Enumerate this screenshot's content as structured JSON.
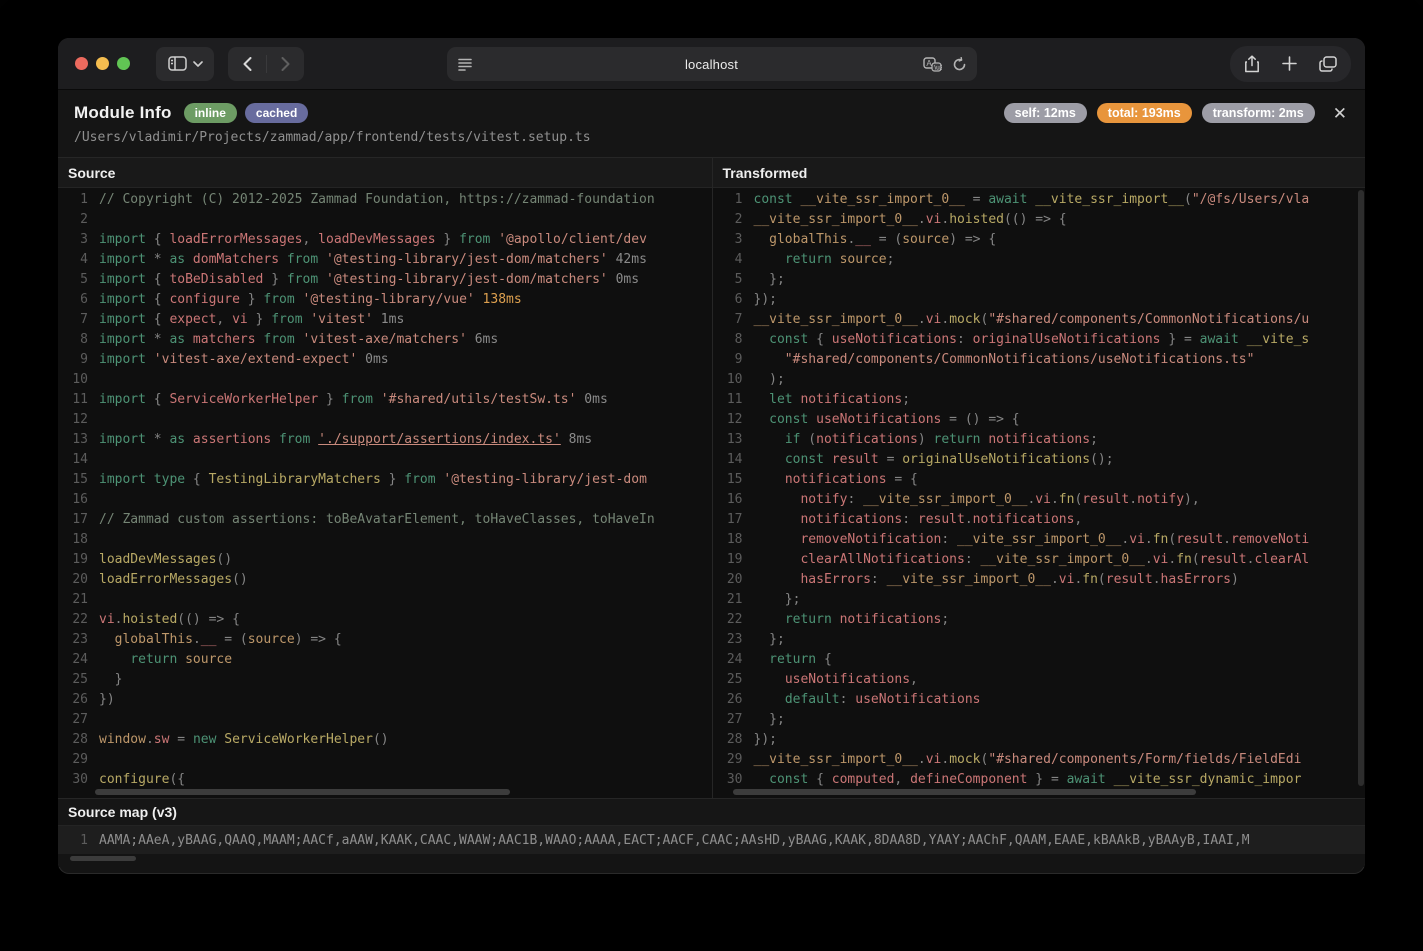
{
  "browser": {
    "url": "localhost",
    "icons": {
      "sidebar": "sidebar-toggle",
      "chevron_down": "chevron-down",
      "back": "chevron-left",
      "forward": "chevron-right",
      "reader": "reader-lines",
      "translate": "translate-badge",
      "reload": "reload-arrow",
      "share": "share-arrow-up",
      "new_tab": "+",
      "tabs": "tab-overview",
      "close": "✕"
    }
  },
  "colors": {
    "badge_inline": "#6d9c64",
    "badge_cached": "#686c9e",
    "pill_gray": "#9d9da6",
    "pill_orange": "#e8953c",
    "syntax": {
      "k": "#4d9375",
      "v": "#bd976a",
      "f": "#b8a965",
      "p": "#cb7676",
      "s": "#c98a7d",
      "c": "#758575",
      "o": "#858585",
      "t": "#8a8a8a",
      "h": "#dda04f",
      "ln": "#5c5c5c"
    }
  },
  "header": {
    "title": "Module Info",
    "badges": [
      {
        "label": "inline",
        "color": "#6d9c64"
      },
      {
        "label": "cached",
        "color": "#686c9e"
      }
    ],
    "timings": [
      {
        "label": "self: 12ms",
        "style": "gray"
      },
      {
        "label": "total: 193ms",
        "style": "orange"
      },
      {
        "label": "transform: 2ms",
        "style": "gray"
      }
    ],
    "file_path": "/Users/vladimir/Projects/zammad/app/frontend/tests/vitest.setup.ts",
    "close_glyph": "✕"
  },
  "panels": {
    "source": {
      "title": "Source",
      "lines": [
        [
          [
            "c",
            "// Copyright (C) 2012-2025 Zammad Foundation, https://zammad-foundation"
          ]
        ],
        [],
        [
          [
            "k",
            "import"
          ],
          [
            "o",
            " { "
          ],
          [
            "p",
            "loadErrorMessages"
          ],
          [
            "o",
            ", "
          ],
          [
            "p",
            "loadDevMessages"
          ],
          [
            "o",
            " } "
          ],
          [
            "k",
            "from"
          ],
          [
            "s",
            " '@apollo/client/dev"
          ]
        ],
        [
          [
            "k",
            "import"
          ],
          [
            "o",
            " * "
          ],
          [
            "k",
            "as"
          ],
          [
            "p",
            " domMatchers "
          ],
          [
            "k",
            "from"
          ],
          [
            "s",
            " '@testing-library/jest-dom/matchers'"
          ],
          [
            "t",
            " 42ms"
          ]
        ],
        [
          [
            "k",
            "import"
          ],
          [
            "o",
            " { "
          ],
          [
            "p",
            "toBeDisabled"
          ],
          [
            "o",
            " } "
          ],
          [
            "k",
            "from"
          ],
          [
            "s",
            " '@testing-library/jest-dom/matchers'"
          ],
          [
            "t",
            " 0ms"
          ]
        ],
        [
          [
            "k",
            "import"
          ],
          [
            "o",
            " { "
          ],
          [
            "p",
            "configure"
          ],
          [
            "o",
            " } "
          ],
          [
            "k",
            "from"
          ],
          [
            "s",
            " '@testing-library/vue'"
          ],
          [
            "h",
            " 138ms"
          ]
        ],
        [
          [
            "k",
            "import"
          ],
          [
            "o",
            " { "
          ],
          [
            "p",
            "expect"
          ],
          [
            "o",
            ", "
          ],
          [
            "p",
            "vi"
          ],
          [
            "o",
            " } "
          ],
          [
            "k",
            "from"
          ],
          [
            "s",
            " 'vitest'"
          ],
          [
            "t",
            " 1ms"
          ]
        ],
        [
          [
            "k",
            "import"
          ],
          [
            "o",
            " * "
          ],
          [
            "k",
            "as"
          ],
          [
            "p",
            " matchers "
          ],
          [
            "k",
            "from"
          ],
          [
            "s",
            " 'vitest-axe/matchers'"
          ],
          [
            "t",
            " 6ms"
          ]
        ],
        [
          [
            "k",
            "import"
          ],
          [
            "s",
            " 'vitest-axe/extend-expect'"
          ],
          [
            "t",
            " 0ms"
          ]
        ],
        [],
        [
          [
            "k",
            "import"
          ],
          [
            "o",
            " { "
          ],
          [
            "p",
            "ServiceWorkerHelper"
          ],
          [
            "o",
            " } "
          ],
          [
            "k",
            "from"
          ],
          [
            "s",
            " '#shared/utils/testSw.ts'"
          ],
          [
            "t",
            " 0ms"
          ]
        ],
        [],
        [
          [
            "k",
            "import"
          ],
          [
            "o",
            " * "
          ],
          [
            "k",
            "as"
          ],
          [
            "p",
            " assertions "
          ],
          [
            "k",
            "from"
          ],
          [
            "o",
            " "
          ],
          [
            "su",
            "'./support/assertions/index.ts'"
          ],
          [
            "t",
            " 8ms"
          ]
        ],
        [],
        [
          [
            "k",
            "import"
          ],
          [
            "o",
            " "
          ],
          [
            "k",
            "type"
          ],
          [
            "o",
            " { "
          ],
          [
            "f",
            "TestingLibraryMatchers"
          ],
          [
            "o",
            " } "
          ],
          [
            "k",
            "from"
          ],
          [
            "s",
            " '@testing-library/jest-dom"
          ]
        ],
        [],
        [
          [
            "c",
            "// Zammad custom assertions: toBeAvatarElement, toHaveClasses, toHaveIn"
          ]
        ],
        [],
        [
          [
            "f",
            "loadDevMessages"
          ],
          [
            "o",
            "()"
          ]
        ],
        [
          [
            "f",
            "loadErrorMessages"
          ],
          [
            "o",
            "()"
          ]
        ],
        [],
        [
          [
            "p",
            "vi"
          ],
          [
            "o",
            "."
          ],
          [
            "f",
            "hoisted"
          ],
          [
            "o",
            "(() => {"
          ]
        ],
        [
          [
            "o",
            "  "
          ],
          [
            "v",
            "globalThis"
          ],
          [
            "o",
            "."
          ],
          [
            "p",
            "__"
          ],
          [
            "o",
            " = ("
          ],
          [
            "v",
            "source"
          ],
          [
            "o",
            ") => {"
          ]
        ],
        [
          [
            "o",
            "    "
          ],
          [
            "k",
            "return"
          ],
          [
            "v",
            " source"
          ]
        ],
        [
          [
            "o",
            "  }"
          ]
        ],
        [
          [
            "o",
            "})"
          ]
        ],
        [],
        [
          [
            "v",
            "window"
          ],
          [
            "o",
            "."
          ],
          [
            "p",
            "sw"
          ],
          [
            "o",
            " = "
          ],
          [
            "k",
            "new"
          ],
          [
            "f",
            " ServiceWorkerHelper"
          ],
          [
            "o",
            "()"
          ]
        ],
        [],
        [
          [
            "f",
            "configure"
          ],
          [
            "o",
            "({"
          ]
        ]
      ]
    },
    "transformed": {
      "title": "Transformed",
      "lines": [
        [
          [
            "k",
            "const"
          ],
          [
            "v",
            " __vite_ssr_import_0__"
          ],
          [
            "o",
            " = "
          ],
          [
            "k",
            "await"
          ],
          [
            "f",
            " __vite_ssr_import__"
          ],
          [
            "o",
            "("
          ],
          [
            "s",
            "\"/@fs/Users/vla"
          ]
        ],
        [
          [
            "v",
            "__vite_ssr_import_0__"
          ],
          [
            "o",
            "."
          ],
          [
            "p",
            "vi"
          ],
          [
            "o",
            "."
          ],
          [
            "f",
            "hoisted"
          ],
          [
            "o",
            "(() => {"
          ]
        ],
        [
          [
            "o",
            "  "
          ],
          [
            "v",
            "globalThis"
          ],
          [
            "o",
            "."
          ],
          [
            "p",
            "__"
          ],
          [
            "o",
            " = ("
          ],
          [
            "v",
            "source"
          ],
          [
            "o",
            ") => {"
          ]
        ],
        [
          [
            "o",
            "    "
          ],
          [
            "k",
            "return"
          ],
          [
            "v",
            " source"
          ],
          [
            "o",
            ";"
          ]
        ],
        [
          [
            "o",
            "  };"
          ]
        ],
        [
          [
            "o",
            "});"
          ]
        ],
        [
          [
            "v",
            "__vite_ssr_import_0__"
          ],
          [
            "o",
            "."
          ],
          [
            "p",
            "vi"
          ],
          [
            "o",
            "."
          ],
          [
            "f",
            "mock"
          ],
          [
            "o",
            "("
          ],
          [
            "s",
            "\"#shared/components/CommonNotifications/u"
          ]
        ],
        [
          [
            "o",
            "  "
          ],
          [
            "k",
            "const"
          ],
          [
            "o",
            " { "
          ],
          [
            "p",
            "useNotifications"
          ],
          [
            "o",
            ": "
          ],
          [
            "p",
            "originalUseNotifications"
          ],
          [
            "o",
            " } = "
          ],
          [
            "k",
            "await"
          ],
          [
            "f",
            " __vite_s"
          ]
        ],
        [
          [
            "s",
            "    \"#shared/components/CommonNotifications/useNotifications.ts\""
          ]
        ],
        [
          [
            "o",
            "  );"
          ]
        ],
        [
          [
            "o",
            "  "
          ],
          [
            "k",
            "let"
          ],
          [
            "p",
            " notifications"
          ],
          [
            "o",
            ";"
          ]
        ],
        [
          [
            "o",
            "  "
          ],
          [
            "k",
            "const"
          ],
          [
            "p",
            " useNotifications"
          ],
          [
            "o",
            " = () => {"
          ]
        ],
        [
          [
            "o",
            "    "
          ],
          [
            "k",
            "if"
          ],
          [
            "o",
            " ("
          ],
          [
            "p",
            "notifications"
          ],
          [
            "o",
            ") "
          ],
          [
            "k",
            "return"
          ],
          [
            "p",
            " notifications"
          ],
          [
            "o",
            ";"
          ]
        ],
        [
          [
            "o",
            "    "
          ],
          [
            "k",
            "const"
          ],
          [
            "p",
            " result"
          ],
          [
            "o",
            " = "
          ],
          [
            "f",
            "originalUseNotifications"
          ],
          [
            "o",
            "();"
          ]
        ],
        [
          [
            "o",
            "    "
          ],
          [
            "p",
            "notifications"
          ],
          [
            "o",
            " = {"
          ]
        ],
        [
          [
            "o",
            "      "
          ],
          [
            "p",
            "notify"
          ],
          [
            "o",
            ": "
          ],
          [
            "v",
            "__vite_ssr_import_0__"
          ],
          [
            "o",
            "."
          ],
          [
            "p",
            "vi"
          ],
          [
            "o",
            "."
          ],
          [
            "f",
            "fn"
          ],
          [
            "o",
            "("
          ],
          [
            "p",
            "result"
          ],
          [
            "o",
            "."
          ],
          [
            "p",
            "notify"
          ],
          [
            "o",
            "),"
          ]
        ],
        [
          [
            "o",
            "      "
          ],
          [
            "p",
            "notifications"
          ],
          [
            "o",
            ": "
          ],
          [
            "p",
            "result"
          ],
          [
            "o",
            "."
          ],
          [
            "p",
            "notifications"
          ],
          [
            "o",
            ","
          ]
        ],
        [
          [
            "o",
            "      "
          ],
          [
            "p",
            "removeNotification"
          ],
          [
            "o",
            ": "
          ],
          [
            "v",
            "__vite_ssr_import_0__"
          ],
          [
            "o",
            "."
          ],
          [
            "p",
            "vi"
          ],
          [
            "o",
            "."
          ],
          [
            "f",
            "fn"
          ],
          [
            "o",
            "("
          ],
          [
            "p",
            "result"
          ],
          [
            "o",
            "."
          ],
          [
            "p",
            "removeNoti"
          ]
        ],
        [
          [
            "o",
            "      "
          ],
          [
            "p",
            "clearAllNotifications"
          ],
          [
            "o",
            ": "
          ],
          [
            "v",
            "__vite_ssr_import_0__"
          ],
          [
            "o",
            "."
          ],
          [
            "p",
            "vi"
          ],
          [
            "o",
            "."
          ],
          [
            "f",
            "fn"
          ],
          [
            "o",
            "("
          ],
          [
            "p",
            "result"
          ],
          [
            "o",
            "."
          ],
          [
            "p",
            "clearAl"
          ]
        ],
        [
          [
            "o",
            "      "
          ],
          [
            "p",
            "hasErrors"
          ],
          [
            "o",
            ": "
          ],
          [
            "v",
            "__vite_ssr_import_0__"
          ],
          [
            "o",
            "."
          ],
          [
            "p",
            "vi"
          ],
          [
            "o",
            "."
          ],
          [
            "f",
            "fn"
          ],
          [
            "o",
            "("
          ],
          [
            "p",
            "result"
          ],
          [
            "o",
            "."
          ],
          [
            "p",
            "hasErrors"
          ],
          [
            "o",
            ")"
          ]
        ],
        [
          [
            "o",
            "    };"
          ]
        ],
        [
          [
            "o",
            "    "
          ],
          [
            "k",
            "return"
          ],
          [
            "p",
            " notifications"
          ],
          [
            "o",
            ";"
          ]
        ],
        [
          [
            "o",
            "  };"
          ]
        ],
        [
          [
            "o",
            "  "
          ],
          [
            "k",
            "return"
          ],
          [
            "o",
            " {"
          ]
        ],
        [
          [
            "o",
            "    "
          ],
          [
            "p",
            "useNotifications"
          ],
          [
            "o",
            ","
          ]
        ],
        [
          [
            "o",
            "    "
          ],
          [
            "k",
            "default"
          ],
          [
            "o",
            ": "
          ],
          [
            "p",
            "useNotifications"
          ]
        ],
        [
          [
            "o",
            "  };"
          ]
        ],
        [
          [
            "o",
            "});"
          ]
        ],
        [
          [
            "v",
            "__vite_ssr_import_0__"
          ],
          [
            "o",
            "."
          ],
          [
            "p",
            "vi"
          ],
          [
            "o",
            "."
          ],
          [
            "f",
            "mock"
          ],
          [
            "o",
            "("
          ],
          [
            "s",
            "\"#shared/components/Form/fields/FieldEdi"
          ]
        ],
        [
          [
            "o",
            "  "
          ],
          [
            "k",
            "const"
          ],
          [
            "o",
            " { "
          ],
          [
            "p",
            "computed"
          ],
          [
            "o",
            ", "
          ],
          [
            "p",
            "defineComponent"
          ],
          [
            "o",
            " } = "
          ],
          [
            "k",
            "await"
          ],
          [
            "f",
            " __vite_ssr_dynamic_impor"
          ]
        ]
      ]
    }
  },
  "sourcemap": {
    "title": "Source map (v3)",
    "line_number": "1",
    "mappings": "AAMA;AAeA,yBAAG,QAAQ,MAAM;AACf,aAAW,KAAK,CAAC,WAAW;AAC1B,WAAO;AAAA,EACT;AACF,CAAC;AAsHD,yBAAG,KAAK,8DAA8D,YAAY;AAChF,QAAM,EAAE,kBAAkB,yBAAyB,IAAI,M"
  }
}
